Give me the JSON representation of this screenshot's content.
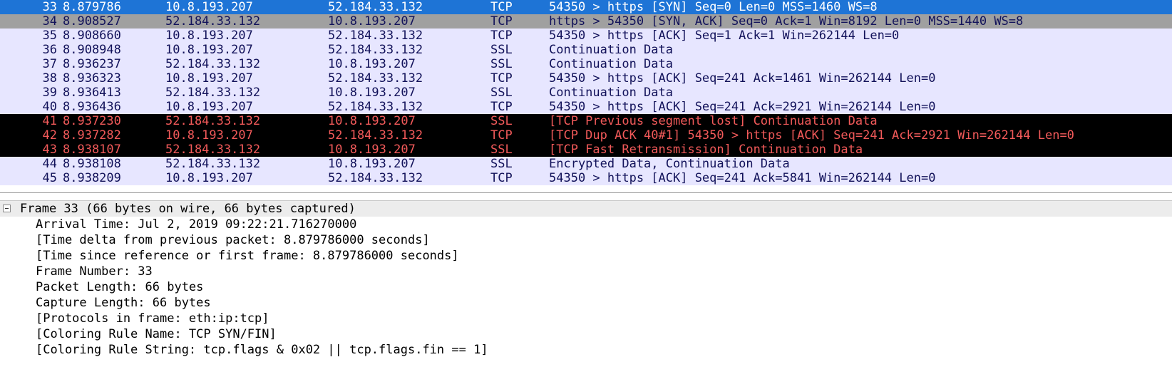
{
  "packets": [
    {
      "no": "33",
      "time": "8.879786",
      "src": "10.8.193.207",
      "dst": "52.184.33.132",
      "proto": "TCP",
      "info": "54350 > https [SYN] Seq=0 Len=0 MSS=1460 WS=8",
      "style": "selected"
    },
    {
      "no": "34",
      "time": "8.908527",
      "src": "52.184.33.132",
      "dst": "10.8.193.207",
      "proto": "TCP",
      "info": "https > 54350 [SYN, ACK] Seq=0 Ack=1 Win=8192 Len=0 MSS=1440 WS=8",
      "style": "syn"
    },
    {
      "no": "35",
      "time": "8.908660",
      "src": "10.8.193.207",
      "dst": "52.184.33.132",
      "proto": "TCP",
      "info": "54350 > https [ACK] Seq=1 Ack=1 Win=262144 Len=0",
      "style": "tcp"
    },
    {
      "no": "36",
      "time": "8.908948",
      "src": "10.8.193.207",
      "dst": "52.184.33.132",
      "proto": "SSL",
      "info": "Continuation Data",
      "style": "ssl"
    },
    {
      "no": "37",
      "time": "8.936237",
      "src": "52.184.33.132",
      "dst": "10.8.193.207",
      "proto": "SSL",
      "info": "Continuation Data",
      "style": "ssl"
    },
    {
      "no": "38",
      "time": "8.936323",
      "src": "10.8.193.207",
      "dst": "52.184.33.132",
      "proto": "TCP",
      "info": "54350 > https [ACK] Seq=241 Ack=1461 Win=262144 Len=0",
      "style": "tcp"
    },
    {
      "no": "39",
      "time": "8.936413",
      "src": "52.184.33.132",
      "dst": "10.8.193.207",
      "proto": "SSL",
      "info": "Continuation Data",
      "style": "ssl"
    },
    {
      "no": "40",
      "time": "8.936436",
      "src": "10.8.193.207",
      "dst": "52.184.33.132",
      "proto": "TCP",
      "info": "54350 > https [ACK] Seq=241 Ack=2921 Win=262144 Len=0",
      "style": "tcp"
    },
    {
      "no": "41",
      "time": "8.937230",
      "src": "52.184.33.132",
      "dst": "10.8.193.207",
      "proto": "SSL",
      "info": "[TCP Previous segment lost] Continuation Data",
      "style": "bad"
    },
    {
      "no": "42",
      "time": "8.937282",
      "src": "10.8.193.207",
      "dst": "52.184.33.132",
      "proto": "TCP",
      "info": "[TCP Dup ACK 40#1] 54350 > https [ACK] Seq=241 Ack=2921 Win=262144 Len=0",
      "style": "bad"
    },
    {
      "no": "43",
      "time": "8.938107",
      "src": "52.184.33.132",
      "dst": "10.8.193.207",
      "proto": "SSL",
      "info": "[TCP Fast Retransmission] Continuation Data",
      "style": "bad"
    },
    {
      "no": "44",
      "time": "8.938108",
      "src": "52.184.33.132",
      "dst": "10.8.193.207",
      "proto": "SSL",
      "info": "Encrypted Data, Continuation Data",
      "style": "ssl"
    },
    {
      "no": "45",
      "time": "8.938209",
      "src": "10.8.193.207",
      "dst": "52.184.33.132",
      "proto": "TCP",
      "info": "54350 > https [ACK] Seq=241 Ack=5841 Win=262144 Len=0",
      "style": "tcp"
    }
  ],
  "details": {
    "root": "Frame 33 (66 bytes on wire, 66 bytes captured)",
    "lines": [
      "Arrival Time: Jul  2, 2019 09:22:21.716270000",
      "[Time delta from previous packet: 8.879786000 seconds]",
      "[Time since reference or first frame: 8.879786000 seconds]",
      "Frame Number: 33",
      "Packet Length: 66 bytes",
      "Capture Length: 66 bytes",
      "[Protocols in frame: eth:ip:tcp]",
      "[Coloring Rule Name: TCP SYN/FIN]",
      "[Coloring Rule String: tcp.flags & 0x02 || tcp.flags.fin == 1]"
    ]
  },
  "colors": {
    "selected_row": "#1e74d6",
    "syn_row": "#a0a0a0",
    "tcp_row": "#e7e6ff",
    "bad_row_bg": "#000000",
    "bad_row_fg": "#f25a5a"
  }
}
